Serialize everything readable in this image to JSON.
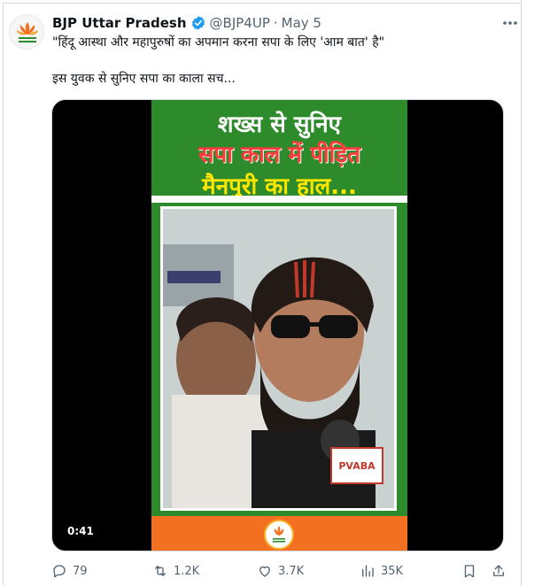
{
  "tweet": {
    "author_name": "BJP Uttar Pradesh",
    "handle": "@BJP4UP",
    "separator": "·",
    "date": "May 5",
    "line1": "\"हिंदू आस्था और महापुरुषों का अपमान करना सपा के लिए 'आम बात' है\"",
    "line2": "इस युवक से सुनिए सपा का काला सच..."
  },
  "video": {
    "headline_1": "शख्स से सुनिए",
    "headline_2": "सपा काल में पीड़ित",
    "headline_3": "मैनपुरी का हाल...",
    "duration": "0:41",
    "mic_text": "PVABA"
  },
  "actions": {
    "replies": "79",
    "reposts": "1.2K",
    "likes": "3.7K",
    "views": "35K"
  },
  "colors": {
    "poster_green": "#2e8b2c",
    "poster_orange": "#f37021",
    "verified_blue": "#1d9bf0",
    "muted_text": "#536471"
  }
}
